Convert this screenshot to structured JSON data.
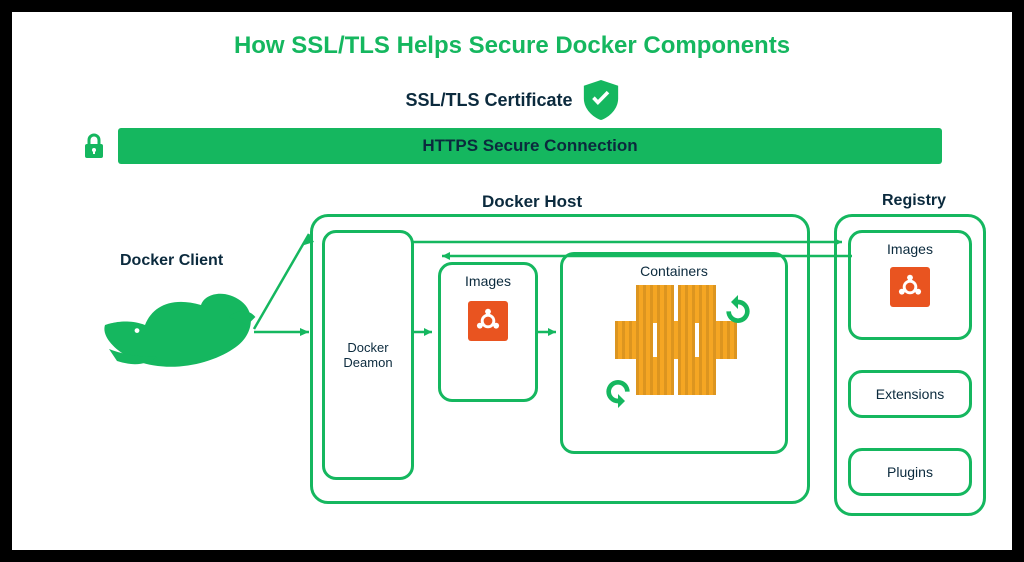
{
  "title": "How SSL/TLS Helps Secure Docker Components",
  "certificate_label": "SSL/TLS Certificate",
  "https_bar": "HTTPS Secure Connection",
  "client_label": "Docker Client",
  "host_label": "Docker Host",
  "daemon_label_1": "Docker",
  "daemon_label_2": "Deamon",
  "images_label": "Images",
  "containers_label": "Containers",
  "registry_label": "Registry",
  "registry_images_label": "Images",
  "registry_ext_label": "Extensions",
  "registry_plugins_label": "Plugins",
  "colors": {
    "green": "#15b75f",
    "navy": "#0b2a3d",
    "orange": "#e95420",
    "amber": "#f5a623"
  },
  "diagram": {
    "nodes": [
      "Docker Client",
      "Docker Host",
      "Docker Deamon",
      "Images",
      "Containers",
      "Registry",
      "Registry Images",
      "Extensions",
      "Plugins"
    ],
    "arrows": [
      {
        "from": "Docker Client",
        "to": "Docker Deamon"
      },
      {
        "from": "Docker Client",
        "to": "Docker Host top"
      },
      {
        "from": "Docker Deamon",
        "to": "Images"
      },
      {
        "from": "Images",
        "to": "Containers"
      },
      {
        "from": "Docker Host",
        "to": "Registry",
        "bidirectional": true
      }
    ]
  }
}
